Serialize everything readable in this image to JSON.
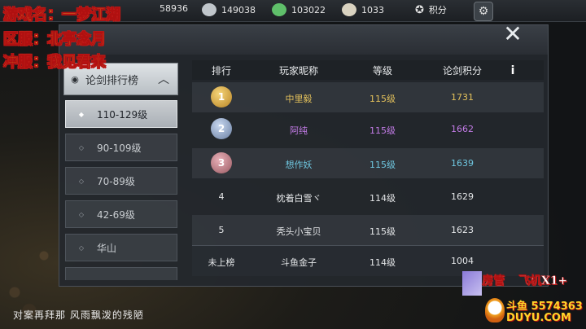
{
  "overlay": {
    "game_name": "游戏名：一梦江湖",
    "server": "区服：北亭念月",
    "rush_server": "冲服：我见君来",
    "bottom_caption": "对案再拜那 风雨飘泼的残陋",
    "room_manager": "房管",
    "plane": "飞机X1+",
    "douyu_id": "斗鱼 5574363",
    "douyu_url": "DUYU.COM"
  },
  "topbar": {
    "res1_value": "58936",
    "res2_value": "149038",
    "res3_value": "103022",
    "res4_value": "1033",
    "points_label": "积分"
  },
  "sidebar": {
    "header_label": "论剑排行榜",
    "items": [
      {
        "label": "110-129级",
        "active": true
      },
      {
        "label": "90-109级",
        "active": false
      },
      {
        "label": "70-89级",
        "active": false
      },
      {
        "label": "42-69级",
        "active": false
      },
      {
        "label": "华山",
        "active": false
      }
    ]
  },
  "table": {
    "headers": [
      "排行",
      "玩家昵称",
      "等级",
      "论剑积分"
    ],
    "info_label": "i",
    "rows": [
      {
        "rank": "1",
        "name": "中里毅",
        "level": "115级",
        "score": "1731",
        "color": "#e2c05b"
      },
      {
        "rank": "2",
        "name": "阿纯",
        "level": "115级",
        "score": "1662",
        "color": "#c27be6"
      },
      {
        "rank": "3",
        "name": "想作妖",
        "level": "115级",
        "score": "1639",
        "color": "#6fc7e0"
      },
      {
        "rank": "4",
        "name": "枕着白雪ヾ",
        "level": "114级",
        "score": "1629",
        "color": "#e3e5e7"
      },
      {
        "rank": "5",
        "name": "秃头小宝贝",
        "level": "115级",
        "score": "1623",
        "color": "#e3e5e7"
      },
      {
        "rank": "未上榜",
        "name": "斗鱼金子",
        "level": "114级",
        "score": "1004",
        "color": "#e3e5e7"
      }
    ]
  }
}
